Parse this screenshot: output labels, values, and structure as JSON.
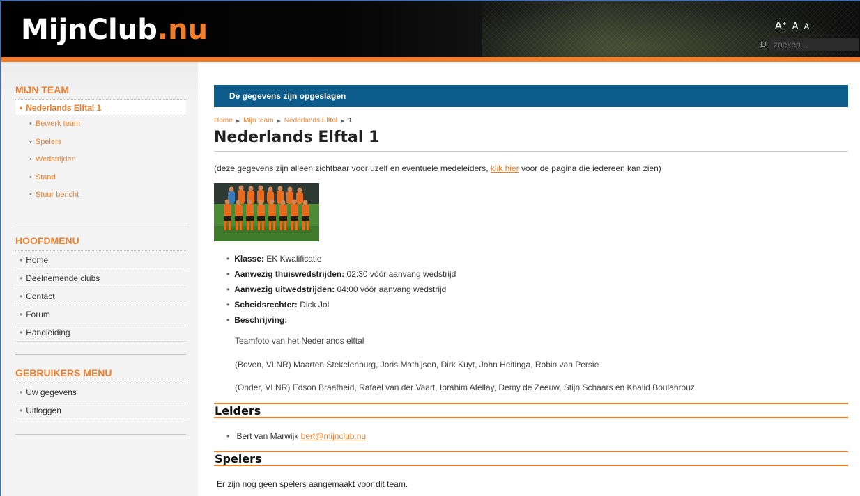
{
  "header": {
    "logo_main": "MijnClub",
    "logo_tld": ".nu",
    "font_large": "A",
    "font_large_sup": "+",
    "font_normal": "A",
    "font_small": "A",
    "font_small_sup": "-",
    "search_placeholder": "zoeken...",
    "search_icon": "search-icon"
  },
  "sidebar": {
    "mijn_team": {
      "heading": "MIJN TEAM",
      "active_item": "Nederlands Elftal 1",
      "sub_items": [
        "Bewerk team",
        "Spelers",
        "Wedstrijden",
        "Stand",
        "Stuur bericht"
      ]
    },
    "hoofdmenu": {
      "heading": "HOOFDMENU",
      "items": [
        "Home",
        "Deelnemende clubs",
        "Contact",
        "Forum",
        "Handleiding"
      ]
    },
    "gebruikers_menu": {
      "heading": "GEBRUIKERS MENU",
      "items": [
        "Uw gegevens",
        "Uitloggen"
      ]
    }
  },
  "main": {
    "notice": "De gegevens zijn opgeslagen",
    "breadcrumb": [
      "Home",
      "Mijn team",
      "Nederlands Elftal",
      "1"
    ],
    "title": "Nederlands Elftal 1",
    "intro_before": "(deze gegevens zijn alleen zichtbaar voor uzelf en eventuele medeleiders, ",
    "intro_link": "klik hier",
    "intro_after": " voor de pagina die iedereen kan zien)",
    "details": [
      {
        "label": "Klasse:",
        "value": " EK Kwalificatie"
      },
      {
        "label": "Aanwezig thuiswedstrijden:",
        "value": " 02:30 vóór aanvang wedstrijd"
      },
      {
        "label": "Aanwezig uitwedstrijden:",
        "value": " 04:00 vóór aanvang wedstrijd"
      },
      {
        "label": "Scheidsrechter:",
        "value": " Dick Jol"
      },
      {
        "label": "Beschrijving:",
        "value": ""
      }
    ],
    "description": [
      "Teamfoto van het Nederlands elftal",
      "(Boven, VLNR) Maarten Stekelenburg, Joris Mathijsen, Dirk Kuyt, John Heitinga, Robin van Persie",
      "(Onder, VLNR) Edson Braafheid, Rafael van der Vaart, Ibrahim Afellay, Demy de Zeeuw, Stijn Schaars en Khalid Boulahrouz"
    ],
    "leiders_heading": "Leiders",
    "leider_name": "Bert van Marwijk ",
    "leider_email": "bert@mijnclub.nu",
    "spelers_heading": "Spelers",
    "no_players": "Er zijn nog geen spelers aangemaakt voor dit team."
  },
  "colors": {
    "accent": "#f07d2a",
    "notice_bg": "#0d5c8c",
    "header_bg": "#000000"
  }
}
